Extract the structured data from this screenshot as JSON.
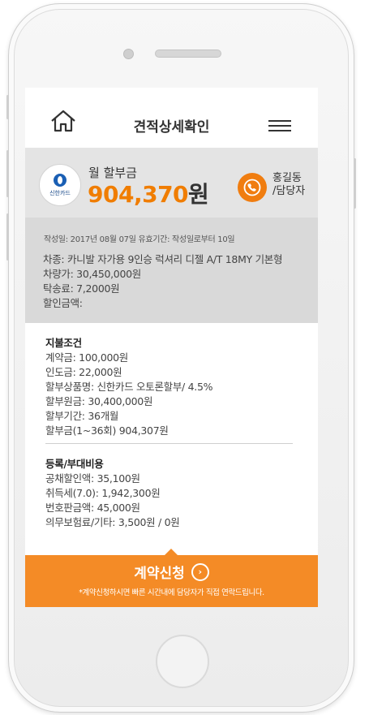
{
  "header": {
    "title": "견적상세확인"
  },
  "summary": {
    "card_name": "신한카드",
    "pay_label": "월 할부금",
    "pay_amount": "904,370",
    "pay_unit": "원",
    "agent_name": "홍길동",
    "agent_role": "/담당자",
    "accent_color": "#f07d00"
  },
  "info": {
    "meta": "작성일: 2017년 08월 07일  유효기간: 작성일로부터 10일",
    "car_model": "차종: 카니발 자가용 9인승 럭셔리 디젤 A/T 18MY 기본형",
    "car_price": "차량가: 30,450,000원",
    "delivery_fee": "탁송료: 7,2000원",
    "discount": "할인금액:"
  },
  "payment": {
    "heading": "지불조건",
    "deposit": "계약금: 100,000원",
    "down_payment": "인도금: 22,000원",
    "product": "할부상품명: 신한카드 오토론할부/ 4.5%",
    "principal": "할부원금: 30,400,000원",
    "period": "할부기간: 36개월",
    "installment": "할부금(1~36회) 904,307원"
  },
  "registration": {
    "heading": "등록/부대비용",
    "bond": "공채할인액: 35,100원",
    "acquisition_tax": "취득세(7.0): 1,942,300원",
    "plate": "번호판금액: 45,000원",
    "insurance": "의무보험료/기타: 3,500원 / 0원"
  },
  "cta": {
    "label": "계약신청",
    "arrow": "›",
    "note": "*계약신청하시면 빠른 시간내에 담당자가 직접 연락드립니다."
  }
}
